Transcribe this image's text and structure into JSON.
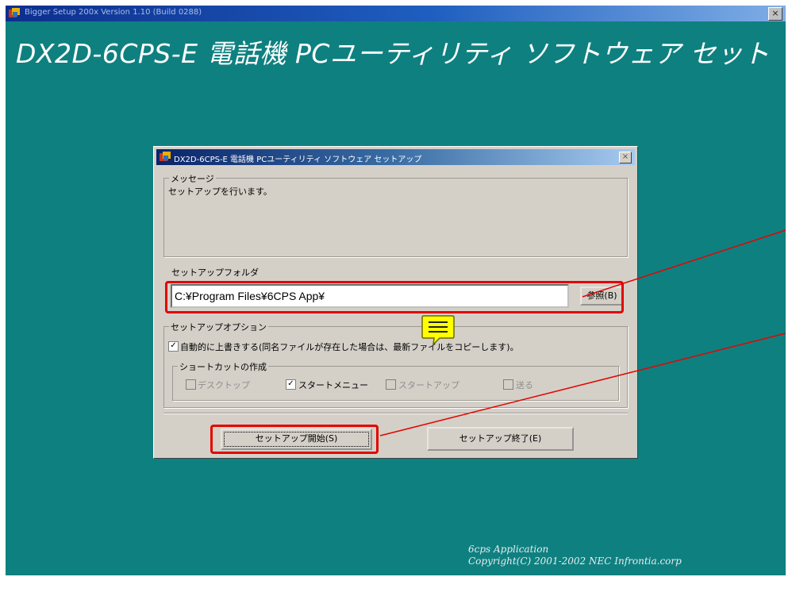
{
  "outer_window": {
    "title": "Bigger Setup 200x  Version 1.10 (Build 0288)",
    "close_glyph": "×",
    "banner": "DX2D-6CPS-E 電話機 PCユーティリティ ソフトウェア セット",
    "copyright_line1": "6cps Application",
    "copyright_line2": "Copyright(C) 2001-2002 NEC Infrontia.corp"
  },
  "dialog": {
    "title": "DX2D-6CPS-E 電話機 PCユーティリティ ソフトウェア セットアップ",
    "close_glyph": "×",
    "message_group": {
      "label": "メッセージ",
      "text": "セットアップを行います。"
    },
    "folder": {
      "label": "セットアップフォルダ",
      "value": "C:¥Program Files¥6CPS App¥",
      "browse_button": "参照(B)"
    },
    "options": {
      "label": "セットアップオプション",
      "overwrite_label": "自動的に上書きする(同名ファイルが存在した場合は、最新ファイルをコピーします)。",
      "overwrite_checked": true,
      "shortcut_group": {
        "label": "ショートカットの作成",
        "items": [
          {
            "label": "デスクトップ",
            "checked": false,
            "enabled": false
          },
          {
            "label": "スタートメニュー",
            "checked": true,
            "enabled": true
          },
          {
            "label": "スタートアップ",
            "checked": false,
            "enabled": false
          },
          {
            "label": "送る",
            "checked": false,
            "enabled": false
          }
        ]
      }
    },
    "start_button": "セットアップ開始(S)",
    "exit_button": "セットアップ終了(E)"
  },
  "colors": {
    "desktop_teal": "#0f8080",
    "dialog_face": "#d4d0c8",
    "annotation_red": "#e10600",
    "callout_yellow": "#ffff00"
  },
  "icons": [
    "setup-app-icon",
    "close-icon",
    "comment-bubble-icon"
  ]
}
